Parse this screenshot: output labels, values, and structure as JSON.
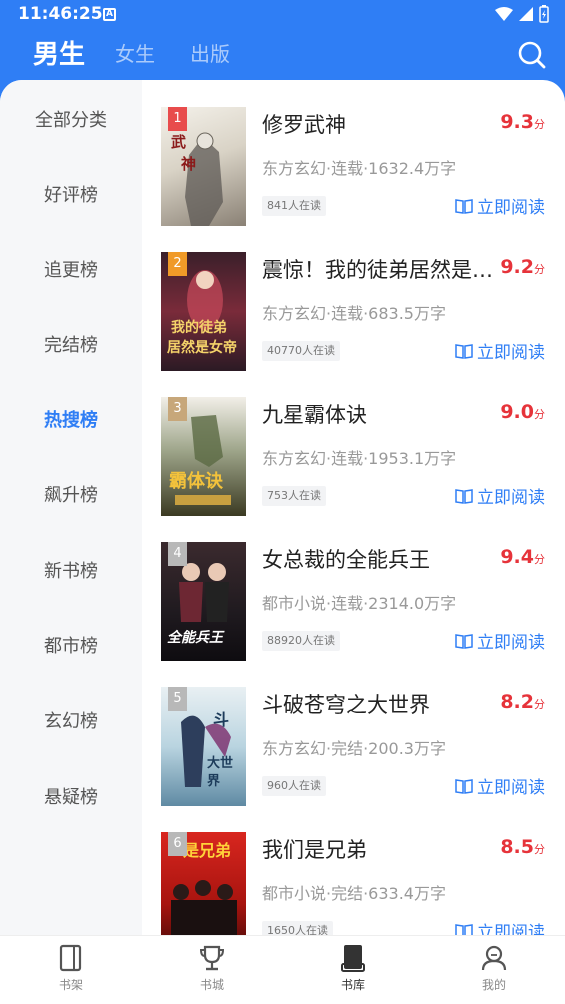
{
  "status": {
    "time": "11:46:25",
    "notif_icon": "A"
  },
  "tabs": [
    {
      "label": "男生",
      "active": true
    },
    {
      "label": "女生",
      "active": false
    },
    {
      "label": "出版",
      "active": false
    }
  ],
  "sidebar": {
    "items": [
      {
        "label": "全部分类"
      },
      {
        "label": "好评榜"
      },
      {
        "label": "追更榜"
      },
      {
        "label": "完结榜"
      },
      {
        "label": "热搜榜",
        "active": true
      },
      {
        "label": "飙升榜"
      },
      {
        "label": "新书榜"
      },
      {
        "label": "都市榜"
      },
      {
        "label": "玄幻榜"
      },
      {
        "label": "悬疑榜"
      }
    ]
  },
  "books": [
    {
      "rank": "1",
      "title": "修罗武神",
      "score": "9.3",
      "unit": "分",
      "meta": "东方玄幻·连载·1632.4万字",
      "readers": "841人在读",
      "action": "立即阅读",
      "rank_color": "#e84c4c"
    },
    {
      "rank": "2",
      "title": "震惊！我的徒弟居然是女帝",
      "score": "9.2",
      "unit": "分",
      "meta": "东方玄幻·连载·683.5万字",
      "readers": "40770人在读",
      "action": "立即阅读",
      "rank_color": "#f09a28"
    },
    {
      "rank": "3",
      "title": "九星霸体诀",
      "score": "9.0",
      "unit": "分",
      "meta": "东方玄幻·连载·1953.1万字",
      "readers": "753人在读",
      "action": "立即阅读",
      "rank_color": "#c7a77a"
    },
    {
      "rank": "4",
      "title": "女总裁的全能兵王",
      "score": "9.4",
      "unit": "分",
      "meta": "都市小说·连载·2314.0万字",
      "readers": "88920人在读",
      "action": "立即阅读",
      "rank_color": "#b8b8b8"
    },
    {
      "rank": "5",
      "title": "斗破苍穹之大世界",
      "score": "8.2",
      "unit": "分",
      "meta": "东方玄幻·完结·200.3万字",
      "readers": "960人在读",
      "action": "立即阅读",
      "rank_color": "#b8b8b8"
    },
    {
      "rank": "6",
      "title": "我们是兄弟",
      "score": "8.5",
      "unit": "分",
      "meta": "都市小说·完结·633.4万字",
      "readers": "1650人在读",
      "action": "立即阅读",
      "rank_color": "#b8b8b8"
    }
  ],
  "bottom_nav": [
    {
      "label": "书架",
      "icon": "bookshelf-icon"
    },
    {
      "label": "书城",
      "icon": "trophy-icon"
    },
    {
      "label": "书库",
      "icon": "library-icon",
      "active": true
    },
    {
      "label": "我的",
      "icon": "profile-icon"
    }
  ],
  "colors": {
    "brand": "#2f7ef5",
    "score": "#e6333a"
  }
}
